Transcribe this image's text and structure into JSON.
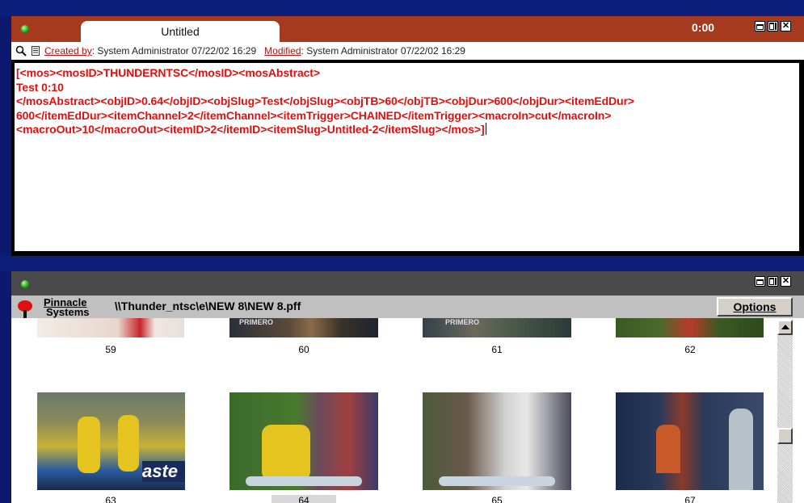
{
  "top_window": {
    "tab_title": "Untitled",
    "timecode": "0:00",
    "info": {
      "created_label": "Created by",
      "created_value": ": System Administrator   07/22/02 16:29",
      "modified_label": "Modified",
      "modified_value": ": System Administrator   07/22/02 16:29"
    },
    "editor_lines": [
      "[<mos><mosID>THUNDERNTSC</mosID><mosAbstract>",
      "Test 0:10",
      "</mosAbstract><objID>0.64</objID><objSlug>Test</objSlug><objTB>60</objTB><objDur>600</objDur><itemEdDur>",
      "600</itemEdDur><itemChannel>2</itemChannel><itemTrigger>CHAINED</itemTrigger><macroIn>cut</macroIn>",
      "<macroOut>10</macroOut><itemID>2</itemID><itemSlug>Untitled-2</itemSlug></mos>]"
    ]
  },
  "bottom_window": {
    "brand_line1": "Pinnacle",
    "brand_line2": "Systems",
    "path": "\\\\Thunder_ntsc\\e\\NEW 8\\NEW 8.pff",
    "options_label": "Options",
    "clips": [
      {
        "number": "59",
        "selected": false
      },
      {
        "number": "60",
        "selected": false
      },
      {
        "number": "61",
        "selected": false
      },
      {
        "number": "62",
        "selected": false
      },
      {
        "number": "63",
        "selected": false
      },
      {
        "number": "64",
        "selected": true
      },
      {
        "number": "65",
        "selected": false
      },
      {
        "number": "67",
        "selected": false
      }
    ]
  },
  "colors": {
    "title_bar_red": "#a63a1e",
    "editor_text": "#e01010",
    "bottom_title_bar": "#4a4a4a",
    "toolbar_gray": "#c0c0c0"
  }
}
